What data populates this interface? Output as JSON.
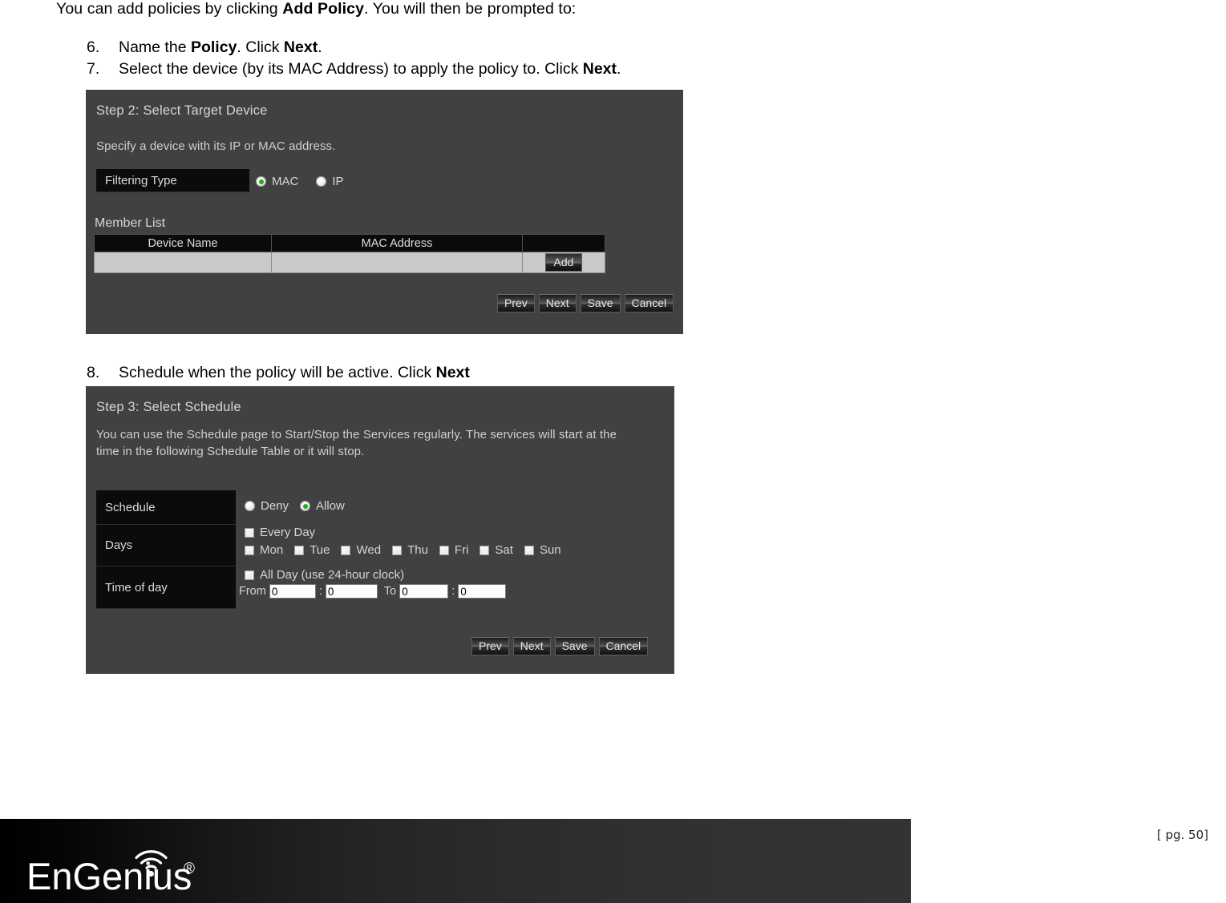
{
  "document": {
    "intro_pre": "You can add policies by clicking ",
    "intro_bold": "Add Policy",
    "intro_post": ". You will then be prompted to:",
    "items": [
      {
        "num": "6.",
        "pre": "Name the ",
        "bold1": "Policy",
        "mid": ". Click ",
        "bold2": "Next",
        "post": "."
      },
      {
        "num": "7.",
        "pre": "Select the device (by its MAC Address) to apply the policy to. Click ",
        "bold1": "Next",
        "mid": "",
        "bold2": "",
        "post": "."
      },
      {
        "num": "8.",
        "pre": "Schedule when the policy will be active. Click ",
        "bold1": "Next",
        "mid": "",
        "bold2": "",
        "post": ""
      }
    ]
  },
  "step2": {
    "title": "Step 2: Select Target Device",
    "description": "Specify a device with its IP or MAC address.",
    "filtering_type_label": "Filtering Type",
    "filtering_options": [
      {
        "label": "MAC",
        "selected": true
      },
      {
        "label": "IP",
        "selected": false
      }
    ],
    "member_list_title": "Member List",
    "table": {
      "headers": [
        "Device Name",
        "MAC Address",
        ""
      ],
      "rows": [
        {
          "device_name": "",
          "mac_address": "",
          "action": "Add"
        }
      ]
    },
    "buttons": [
      "Prev",
      "Next",
      "Save",
      "Cancel"
    ]
  },
  "step3": {
    "title": "Step 3: Select Schedule",
    "description": "You can use the Schedule page to Start/Stop the Services regularly. The services will start at the time in the following Schedule Table or it will stop.",
    "rows": [
      {
        "label": "Schedule"
      },
      {
        "label": "Days"
      },
      {
        "label": "Time of day"
      }
    ],
    "schedule_options": [
      {
        "label": "Deny",
        "selected": false
      },
      {
        "label": "Allow",
        "selected": true
      }
    ],
    "every_day": {
      "label": "Every Day",
      "checked": false
    },
    "days": [
      {
        "label": "Mon",
        "checked": false
      },
      {
        "label": "Tue",
        "checked": false
      },
      {
        "label": "Wed",
        "checked": false
      },
      {
        "label": "Thu",
        "checked": false
      },
      {
        "label": "Fri",
        "checked": false
      },
      {
        "label": "Sat",
        "checked": false
      },
      {
        "label": "Sun",
        "checked": false
      }
    ],
    "all_day": {
      "label": "All Day (use 24-hour clock)",
      "checked": false
    },
    "time": {
      "from_label": "From",
      "to_label": "To",
      "colon": ":",
      "from_hour": "0",
      "from_min": "0",
      "to_hour": "0",
      "to_min": "0"
    },
    "buttons": [
      "Prev",
      "Next",
      "Save",
      "Cancel"
    ]
  },
  "footer": {
    "brand": "EnGenius",
    "registered_mark": "®",
    "page_label": "[ pg. 50]"
  },
  "colors": {
    "panel_bg": "#414141",
    "label_box_bg": "#0b0b0b",
    "radio_selected": "#17b317",
    "table_header_bg": "#0a0a0a",
    "table_row_bg": "#c9c9c9",
    "footer_dark": "#333333"
  }
}
